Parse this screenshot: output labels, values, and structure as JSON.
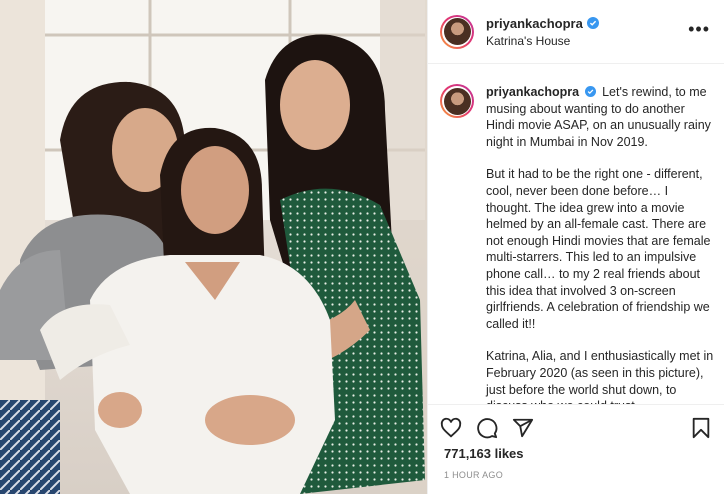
{
  "post": {
    "username": "priyankachopra",
    "location": "Katrina's House",
    "more_label": "•••",
    "caption": {
      "p1": "Let's rewind, to me musing about wanting to do another Hindi movie ASAP, on an unusually rainy night in Mumbai in Nov 2019.",
      "p2": "But it had to be the right one - different, cool, never been done before… I thought. The idea grew into a movie helmed by an all-female cast. There are not enough Hindi movies that are female multi-starrers. This led to an impulsive phone call… to my 2 real friends about this idea that involved 3 on-screen girlfriends. A celebration of friendship we called it!!",
      "p3": "Katrina, Alia, and I enthusiastically met in February 2020 (as seen in this picture), just before the world shut down, to discuss who we could trust"
    },
    "likes": "771,163 likes",
    "timestamp": "1 HOUR AGO"
  },
  "icons": {
    "like": "heart-icon",
    "comment": "comment-icon",
    "share": "share-icon",
    "save": "bookmark-icon",
    "verified": "verified-badge-icon"
  },
  "colors": {
    "text": "#262626",
    "muted": "#8e8e8e",
    "verified": "#3897f0",
    "border": "#efefef"
  }
}
